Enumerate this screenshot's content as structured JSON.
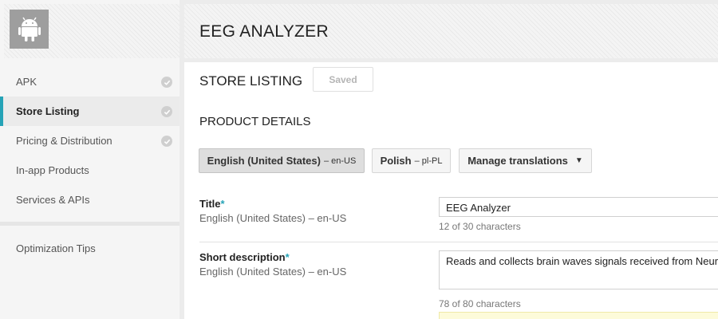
{
  "app": {
    "title": "EEG ANALYZER"
  },
  "sidebar": {
    "items": [
      {
        "label": "APK",
        "completed": true,
        "active": false
      },
      {
        "label": "Store Listing",
        "completed": true,
        "active": true
      },
      {
        "label": "Pricing & Distribution",
        "completed": true,
        "active": false
      },
      {
        "label": "In-app Products",
        "completed": false,
        "active": false
      },
      {
        "label": "Services & APIs",
        "completed": false,
        "active": false
      }
    ],
    "secondary": [
      {
        "label": "Optimization Tips"
      }
    ]
  },
  "page": {
    "section_title": "STORE LISTING",
    "saved_label": "Saved",
    "product_details_title": "PRODUCT DETAILS"
  },
  "languages": {
    "primary": {
      "name": "English (United States)",
      "code": "– en-US"
    },
    "secondary": {
      "name": "Polish",
      "code": "– pl-PL"
    },
    "manage_label": "Manage translations",
    "manage_caret": "▼"
  },
  "fields": {
    "title": {
      "label": "Title",
      "required_mark": "*",
      "language": "English (United States) – en-US",
      "value": "EEG Analyzer",
      "counter": "12 of 30 characters"
    },
    "short_description": {
      "label": "Short description",
      "required_mark": "*",
      "language": "English (United States) – en-US",
      "value": "Reads and collects brain waves signals received from Neur",
      "counter": "78 of 80 characters"
    }
  },
  "colors": {
    "accent": "#26a3b7",
    "active_bg": "#ebebeb"
  },
  "icons": {
    "app": "android-icon",
    "status": "check-circle-icon",
    "dropdown": "caret-down-icon"
  }
}
